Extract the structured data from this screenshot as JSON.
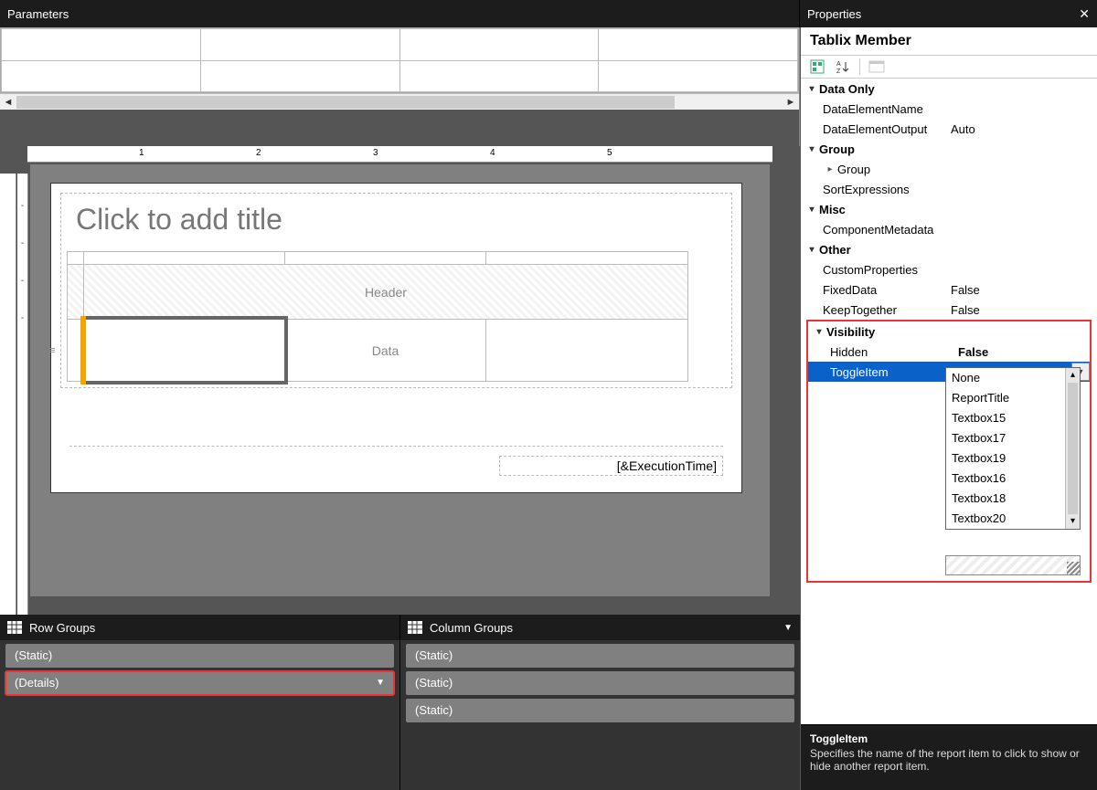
{
  "parameters": {
    "title": "Parameters"
  },
  "design": {
    "title_placeholder": "Click to add title",
    "header_label": "Header",
    "data_label": "Data",
    "footer_field": "[&ExecutionTime]",
    "ruler_numbers": [
      "1",
      "2",
      "3",
      "4",
      "5"
    ]
  },
  "groups": {
    "row_title": "Row Groups",
    "col_title": "Column Groups",
    "row_items": [
      "(Static)",
      "(Details)"
    ],
    "col_items": [
      "(Static)",
      "(Static)",
      "(Static)"
    ]
  },
  "properties": {
    "title": "Properties",
    "object": "Tablix Member",
    "categories": {
      "data_only": {
        "label": "Data Only",
        "rows": [
          {
            "name": "DataElementName",
            "value": ""
          },
          {
            "name": "DataElementOutput",
            "value": "Auto"
          }
        ]
      },
      "group": {
        "label": "Group",
        "rows": [
          {
            "name": "Group",
            "value": "",
            "expandable": true
          },
          {
            "name": "SortExpressions",
            "value": ""
          }
        ]
      },
      "misc": {
        "label": "Misc",
        "rows": [
          {
            "name": "ComponentMetadata",
            "value": ""
          }
        ]
      },
      "other": {
        "label": "Other",
        "rows": [
          {
            "name": "CustomProperties",
            "value": ""
          },
          {
            "name": "FixedData",
            "value": "False"
          },
          {
            "name": "KeepTogether",
            "value": "False"
          }
        ]
      },
      "visibility": {
        "label": "Visibility",
        "rows": [
          {
            "name": "Hidden",
            "value": "False",
            "bold": true
          },
          {
            "name": "ToggleItem",
            "value": "",
            "selected": true,
            "dropdown_open": true
          }
        ],
        "dropdown_options": [
          "None",
          "ReportTitle",
          "Textbox15",
          "Textbox17",
          "Textbox19",
          "Textbox16",
          "Textbox18",
          "Textbox20"
        ]
      }
    },
    "description": {
      "name": "ToggleItem",
      "text": "Specifies the name of the report item to click to show or hide another report item."
    }
  }
}
